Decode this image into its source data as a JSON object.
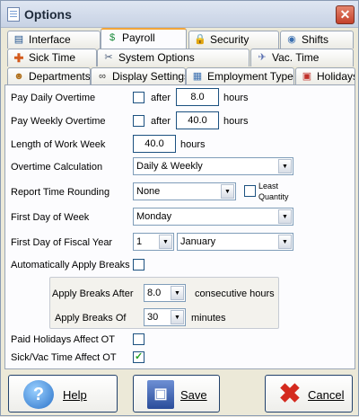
{
  "window": {
    "title": "Options",
    "close_label": "✕"
  },
  "tabs": {
    "interface": "Interface",
    "payroll": "Payroll",
    "security": "Security",
    "shifts": "Shifts",
    "sick_time": "Sick Time",
    "system_options": "System Options",
    "vac_time": "Vac. Time",
    "departments": "Departments",
    "display_settings": "Display Settings",
    "employment_types": "Employment Types",
    "holidays": "Holidays"
  },
  "form": {
    "pay_daily_overtime": {
      "label": "Pay Daily Overtime",
      "after": "after",
      "value": "8.0",
      "unit": "hours"
    },
    "pay_weekly_overtime": {
      "label": "Pay Weekly Overtime",
      "after": "after",
      "value": "40.0",
      "unit": "hours"
    },
    "length_of_work_week": {
      "label": "Length of Work Week",
      "value": "40.0",
      "unit": "hours"
    },
    "overtime_calculation": {
      "label": "Overtime Calculation",
      "value": "Daily & Weekly"
    },
    "report_time_rounding": {
      "label": "Report Time Rounding",
      "value": "None",
      "least_quantity_1": "Least",
      "least_quantity_2": "Quantity"
    },
    "first_day_of_week": {
      "label": "First Day of Week",
      "value": "Monday"
    },
    "first_day_of_fiscal_year": {
      "label": "First Day of Fiscal Year",
      "day": "1",
      "month": "January"
    },
    "auto_apply_breaks": {
      "label": "Automatically Apply Breaks"
    },
    "apply_breaks_after": {
      "label": "Apply Breaks After",
      "value": "8.0",
      "unit": "consecutive hours"
    },
    "apply_breaks_of": {
      "label": "Apply Breaks Of",
      "value": "30",
      "unit": "minutes"
    },
    "paid_holidays_affect_ot": {
      "label": "Paid Holidays Affect OT",
      "checked": false
    },
    "sick_vac_affect_ot": {
      "label": "Sick/Vac Time Affect OT",
      "checked": true
    }
  },
  "buttons": {
    "help": "Help",
    "save": "Save",
    "cancel": "Cancel"
  },
  "colors": {
    "accent": "#f2a53a",
    "border": "#1c5180",
    "check": "#21a121"
  }
}
